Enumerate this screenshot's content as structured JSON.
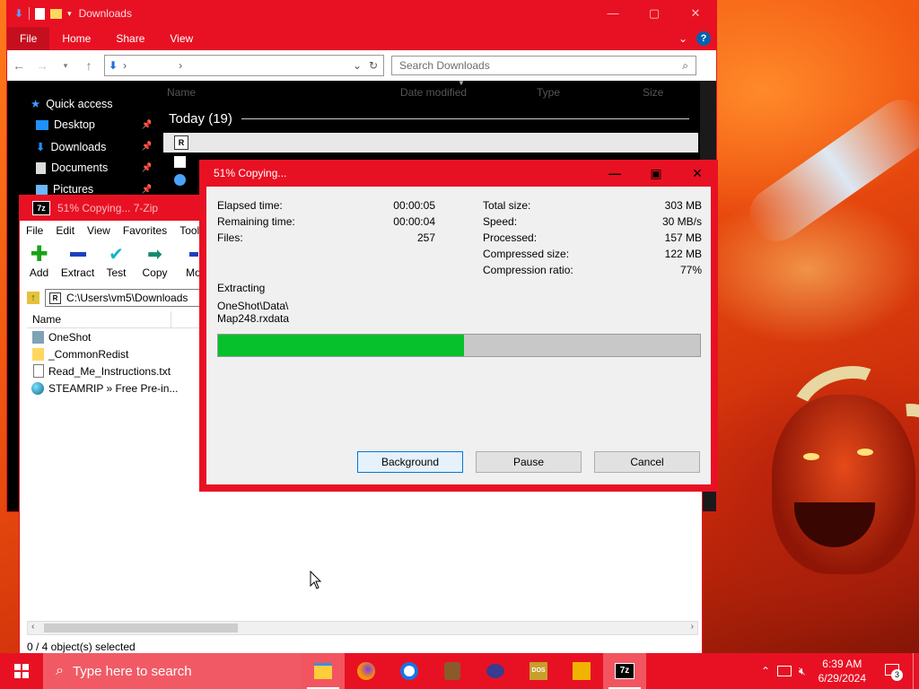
{
  "explorer": {
    "title": "Downloads",
    "ribbon_tabs": [
      "File",
      "Home",
      "Share",
      "View"
    ],
    "search_placeholder": "Search Downloads",
    "columns": [
      "Name",
      "Date modified",
      "Type",
      "Size"
    ],
    "group_label": "Today (19)",
    "nav_items": [
      "Quick access",
      "Desktop",
      "Downloads",
      "Documents",
      "Pictures"
    ]
  },
  "zip": {
    "title": "51% Copying... 7-Zip",
    "menu": [
      "File",
      "Edit",
      "View",
      "Favorites",
      "Tools"
    ],
    "toolbar": [
      "Add",
      "Extract",
      "Test",
      "Copy",
      "Mo"
    ],
    "path": "C:\\Users\\vm5\\Downloads",
    "column_name": "Name",
    "files": [
      {
        "name": "OneShot",
        "icon": "folder-icon"
      },
      {
        "name": "_CommonRedist",
        "icon": "folder-icon"
      },
      {
        "name": "Read_Me_Instructions.txt",
        "icon": "text-file-icon"
      },
      {
        "name": "STEAMRIP  » Free Pre-in...",
        "icon": "globe-shortcut-icon"
      }
    ],
    "status": "0 / 4 object(s) selected"
  },
  "dialog": {
    "title": "51% Copying...",
    "elapsed_label": "Elapsed time:",
    "elapsed_value": "00:00:05",
    "remaining_label": "Remaining time:",
    "remaining_value": "00:00:04",
    "files_label": "Files:",
    "files_value": "257",
    "total_label": "Total size:",
    "total_value": "303 MB",
    "speed_label": "Speed:",
    "speed_value": "30 MB/s",
    "processed_label": "Processed:",
    "processed_value": "157 MB",
    "compressed_label": "Compressed size:",
    "compressed_value": "122 MB",
    "ratio_label": "Compression ratio:",
    "ratio_value": "77%",
    "operation": "Extracting",
    "current_file_line1": "OneShot\\Data\\",
    "current_file_line2": "Map248.rxdata",
    "progress": 0.51,
    "buttons": {
      "background": "Background",
      "pause": "Pause",
      "cancel": "Cancel"
    }
  },
  "taskbar": {
    "search_placeholder": "Type here to search",
    "time": "6:39 AM",
    "date": "6/29/2024",
    "notification_count": "3"
  },
  "colors": {
    "accent": "#e81123",
    "progress": "#06c12c"
  }
}
